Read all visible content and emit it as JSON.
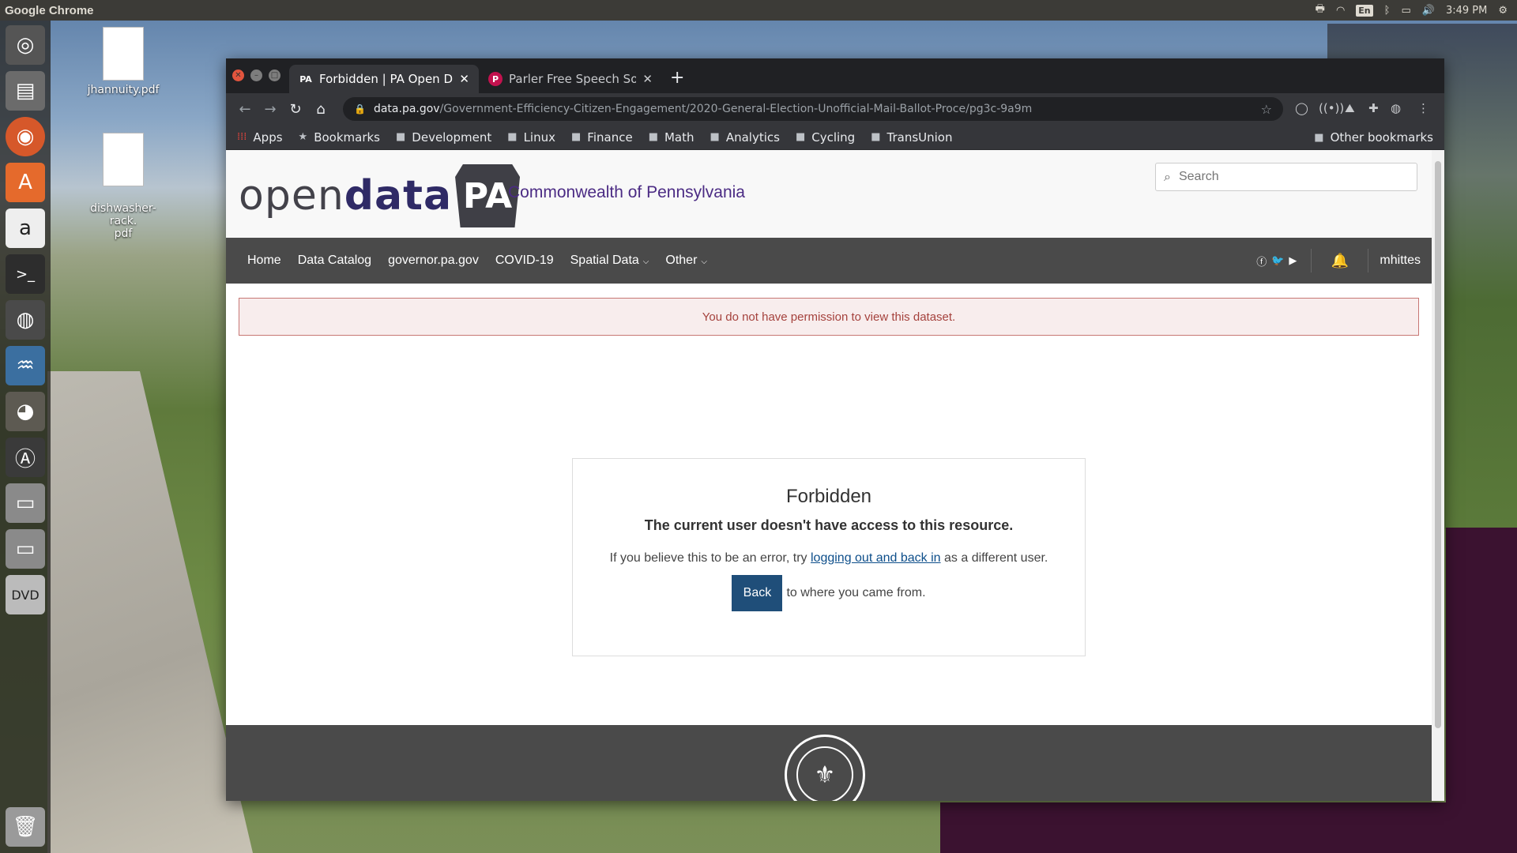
{
  "top_panel": {
    "app_name": "Google Chrome",
    "language": "En",
    "clock": "3:49 PM"
  },
  "desktop_icons": [
    {
      "label": "jhannuity.pdf"
    },
    {
      "label": "dishwasher-rack.\npdf"
    }
  ],
  "tabs": [
    {
      "favicon": "PA",
      "title": "Forbidden | PA Open Data",
      "active": true
    },
    {
      "favicon": "P",
      "title": "Parler Free Speech Social",
      "active": false
    }
  ],
  "omnibox": {
    "host": "data.pa.gov",
    "path": "/Government-Efficiency-Citizen-Engagement/2020-General-Election-Unofficial-Mail-Ballot-Proce/pg3c-9a9m"
  },
  "bookmarks": {
    "items": [
      {
        "label": "Apps",
        "icon": "apps-grid-icon"
      },
      {
        "label": "Bookmarks",
        "icon": "star-icon"
      },
      {
        "label": "Development",
        "icon": "folder-icon"
      },
      {
        "label": "Linux",
        "icon": "folder-icon"
      },
      {
        "label": "Finance",
        "icon": "folder-icon"
      },
      {
        "label": "Math",
        "icon": "folder-icon"
      },
      {
        "label": "Analytics",
        "icon": "folder-icon"
      },
      {
        "label": "Cycling",
        "icon": "folder-icon"
      },
      {
        "label": "TransUnion",
        "icon": "folder-icon"
      }
    ],
    "other": "Other bookmarks"
  },
  "site": {
    "logo_open": "open",
    "logo_data": "data",
    "logo_pa": "PA",
    "tagline": "Commonwealth of Pennsylvania",
    "search_placeholder": "Search",
    "nav": [
      {
        "label": "Home",
        "dropdown": false
      },
      {
        "label": "Data Catalog",
        "dropdown": false
      },
      {
        "label": "governor.pa.gov",
        "dropdown": false
      },
      {
        "label": "COVID-19",
        "dropdown": false
      },
      {
        "label": "Spatial Data",
        "dropdown": true
      },
      {
        "label": "Other",
        "dropdown": true
      }
    ],
    "username": "mhittes",
    "alert": "You do not have permission to view this dataset."
  },
  "forbidden": {
    "title": "Forbidden",
    "subtitle": "The current user doesn't have access to this resource.",
    "msg_before": "If you believe this to be an error, try ",
    "msg_link": "logging out and back in",
    "msg_after": " as a different user.",
    "back_label": "Back",
    "back_after": "to where you came from."
  },
  "colors": {
    "brand_purple": "#4b2b84",
    "nav_bg": "#4a4a4a",
    "alert_text": "#a5423d",
    "back_button": "#1f4e79"
  }
}
